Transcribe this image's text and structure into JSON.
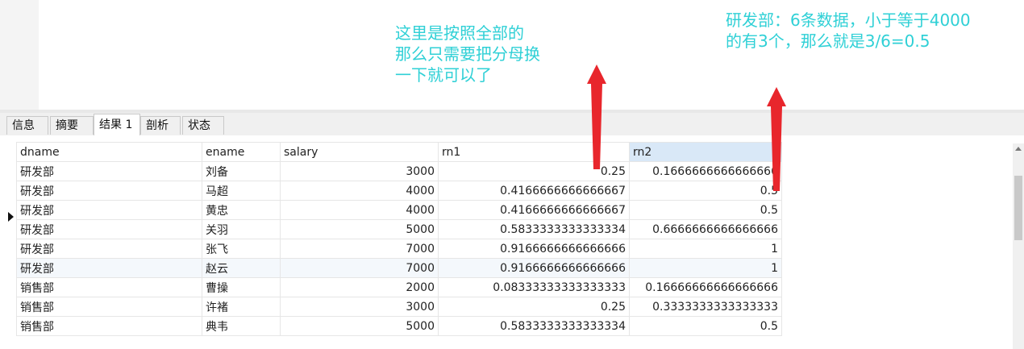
{
  "tabs": [
    {
      "label": "信息"
    },
    {
      "label": "摘要"
    },
    {
      "label": "结果 1"
    },
    {
      "label": "剖析"
    },
    {
      "label": "状态"
    }
  ],
  "active_tab": "结果 1",
  "table": {
    "columns": [
      "dname",
      "ename",
      "salary",
      "rn1",
      "rn2"
    ],
    "selected_column": "rn2",
    "rows": [
      {
        "dname": "研发部",
        "ename": "刘备",
        "salary": "3000",
        "rn1": "0.25",
        "rn2": "0.1666666666666666"
      },
      {
        "dname": "研发部",
        "ename": "马超",
        "salary": "4000",
        "rn1": "0.4166666666666667",
        "rn2": "0.5"
      },
      {
        "dname": "研发部",
        "ename": "黄忠",
        "salary": "4000",
        "rn1": "0.4166666666666667",
        "rn2": "0.5"
      },
      {
        "dname": "研发部",
        "ename": "关羽",
        "salary": "5000",
        "rn1": "0.5833333333333334",
        "rn2": "0.6666666666666666"
      },
      {
        "dname": "研发部",
        "ename": "张飞",
        "salary": "7000",
        "rn1": "0.9166666666666666",
        "rn2": "1"
      },
      {
        "dname": "研发部",
        "ename": "赵云",
        "salary": "7000",
        "rn1": "0.9166666666666666",
        "rn2": "1"
      },
      {
        "dname": "销售部",
        "ename": "曹操",
        "salary": "2000",
        "rn1": "0.08333333333333333",
        "rn2": "0.16666666666666666"
      },
      {
        "dname": "销售部",
        "ename": "许褚",
        "salary": "3000",
        "rn1": "0.25",
        "rn2": "0.3333333333333333"
      },
      {
        "dname": "销售部",
        "ename": "典韦",
        "salary": "5000",
        "rn1": "0.5833333333333334",
        "rn2": "0.5"
      }
    ],
    "current_row": 2
  },
  "annotations": {
    "note1": [
      "这里是按照全部的",
      "那么只需要把分母换",
      "一下就可以了"
    ],
    "note2": [
      "研发部：6条数据，小于等于4000",
      "的有3个，那么就是3/6=0.5"
    ],
    "color": "#2fd0d6",
    "arrow_color": "#e8262c"
  }
}
